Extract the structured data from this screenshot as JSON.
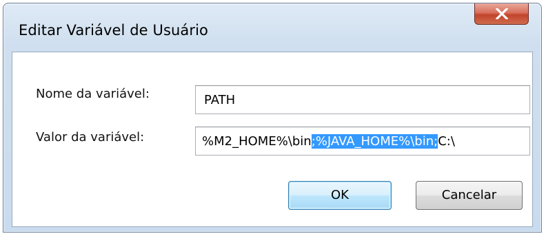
{
  "window": {
    "title": "Editar Variável de Usuário",
    "close_icon": "close-icon"
  },
  "form": {
    "name_label": "Nome da variável:",
    "name_value": "PATH",
    "value_label": "Valor da variável:",
    "value_prefix": "%M2_HOME%\\bin",
    "value_selected": ";%JAVA_HOME%\\bin;",
    "value_suffix": "C:\\"
  },
  "buttons": {
    "ok_label": "OK",
    "cancel_label": "Cancelar"
  },
  "colors": {
    "selection": "#3399ff",
    "close_button": "#c2452c",
    "window_frame": "#cfdfef"
  }
}
